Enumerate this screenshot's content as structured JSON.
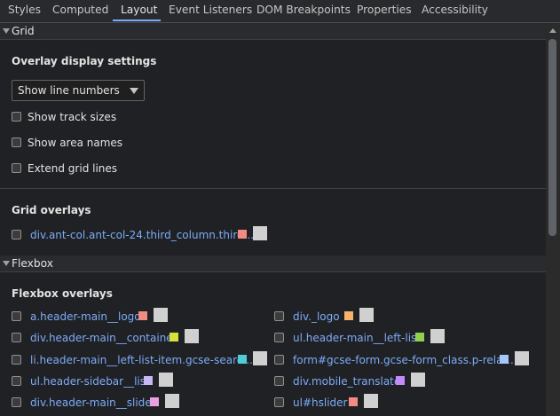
{
  "tabs": [
    {
      "label": "Styles"
    },
    {
      "label": "Computed"
    },
    {
      "label": "Layout"
    },
    {
      "label": "Event Listeners"
    },
    {
      "label": "DOM Breakpoints"
    },
    {
      "label": "Properties"
    },
    {
      "label": "Accessibility"
    }
  ],
  "active_tab": "Layout",
  "grid": {
    "section_title": "Grid",
    "overlay_settings_title": "Overlay display settings",
    "select_value": "Show line numbers",
    "options": [
      {
        "label": "Show track sizes",
        "checked": false
      },
      {
        "label": "Show area names",
        "checked": false
      },
      {
        "label": "Extend grid lines",
        "checked": false
      }
    ],
    "overlays_title": "Grid overlays",
    "overlays": [
      {
        "tag": "div",
        "selector": ".ant-col.ant-col-24.third_column.third...",
        "color": "#f28b82",
        "checked": false
      }
    ]
  },
  "flexbox": {
    "section_title": "Flexbox",
    "overlays_title": "Flexbox overlays",
    "overlays": [
      {
        "tag": "a",
        "selector": ".header-main__logo",
        "color": "#f28b82",
        "checked": false
      },
      {
        "tag": "div",
        "selector": "._logo",
        "color": "#f6b26b",
        "checked": false
      },
      {
        "tag": "div",
        "selector": ".header-main__container",
        "color": "#d9e23a",
        "checked": false
      },
      {
        "tag": "ul",
        "selector": ".header-main__left-list",
        "color": "#8fd14f",
        "checked": false
      },
      {
        "tag": "li",
        "selector": ".header-main__left-list-item.gcse-searc...",
        "color": "#4ecdd6",
        "checked": false
      },
      {
        "tag": "form",
        "selector": "#gcse-form.gcse-form_class.p-relat...",
        "color": "#a7c7fa",
        "checked": false
      },
      {
        "tag": "ul",
        "selector": ".header-sidebar__list",
        "color": "#c5b8f5",
        "checked": false
      },
      {
        "tag": "div",
        "selector": ".mobile_translate",
        "color": "#c58af9",
        "checked": false
      },
      {
        "tag": "div",
        "selector": ".header-main__slider",
        "color": "#e8a0e0",
        "checked": false
      },
      {
        "tag": "ul",
        "selector": "#hslider",
        "color": "#f28b82",
        "checked": false
      }
    ]
  }
}
